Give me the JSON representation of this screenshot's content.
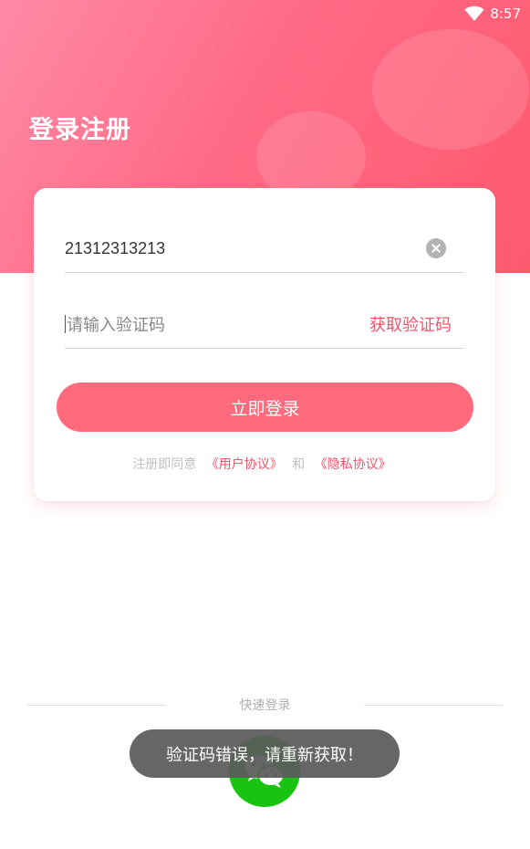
{
  "status_bar": {
    "time": "8:57",
    "wifi_icon": "wifi-icon"
  },
  "header": {
    "title": "登录注册",
    "gradient_start": "#ff8aa6",
    "gradient_end": "#fd5a6e"
  },
  "form": {
    "phone_value": "21312313213",
    "clear_icon": "clear-icon",
    "code_placeholder": "请输入验证码",
    "get_code_label": "获取验证码",
    "login_label": "立即登录",
    "agreement_prefix": "注册即同意",
    "user_agreement": "《用户协议》",
    "and_text": "和",
    "privacy_policy": "《隐私协议》"
  },
  "quick_login": {
    "label": "快速登录",
    "wechat_icon": "wechat-icon"
  },
  "toast": {
    "message": "验证码错误，请重新获取！"
  },
  "colors": {
    "accent": "#f2546b",
    "button": "#ff6a7d",
    "wechat": "#19c311"
  }
}
